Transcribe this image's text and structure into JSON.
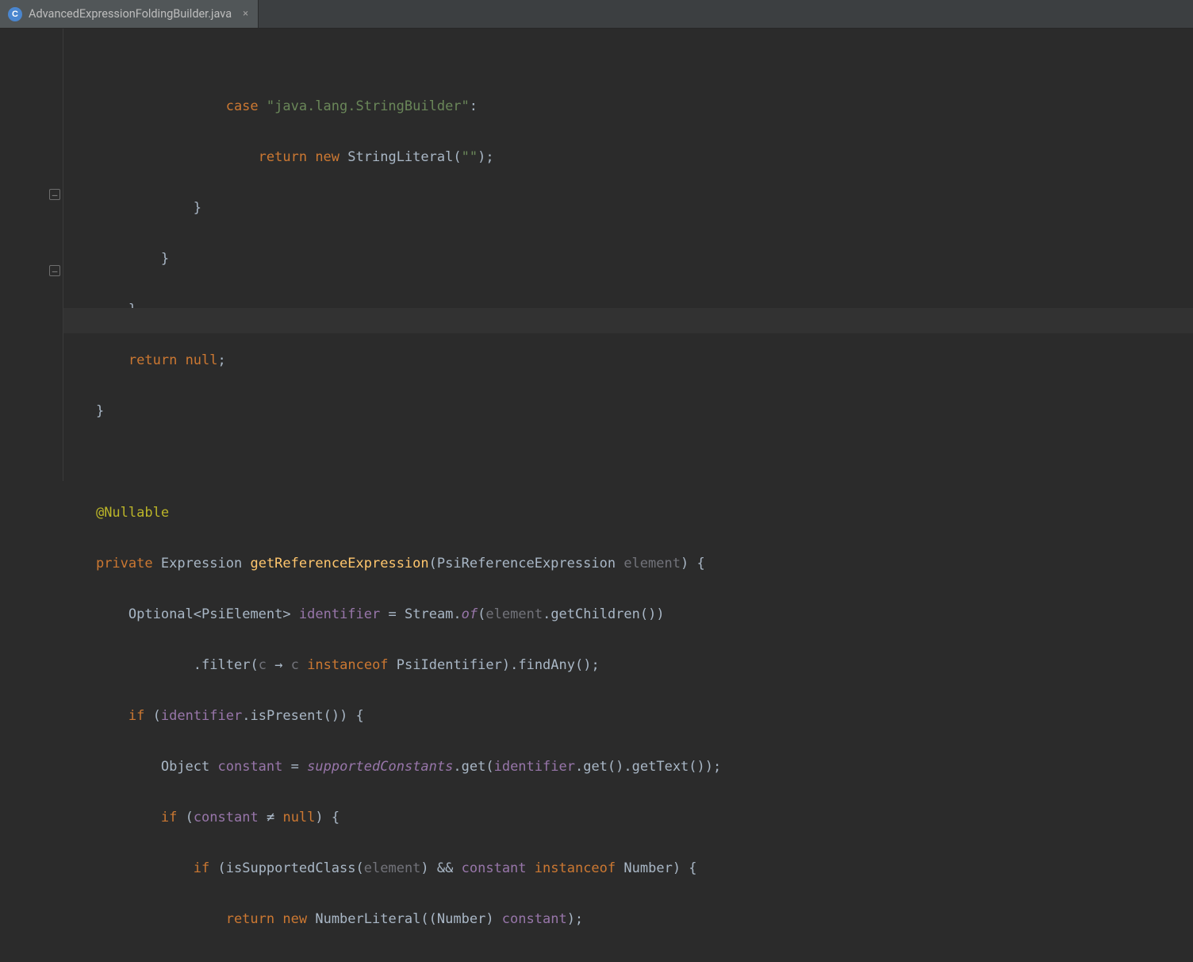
{
  "tab": {
    "filename": "AdvancedExpressionFoldingBuilder.java",
    "file_icon_letter": "C"
  },
  "code": {
    "l1": {
      "kw_case": "case",
      "str": "\"java.lang.StringBuilder\""
    },
    "l2": {
      "kw_return": "return",
      "kw_new": "new",
      "call": "StringLiteral",
      "str": "\"\""
    },
    "l6": {
      "kw_return": "return",
      "kw_null": "null"
    },
    "l9": {
      "ann": "@Nullable"
    },
    "l10": {
      "kw_private": "private",
      "type": "Expression",
      "fn": "getReferenceExpression",
      "ptype": "PsiReferenceExpression",
      "pname": "element"
    },
    "l11": {
      "t1": "Optional",
      "t2": "PsiElement",
      "var": "identifier",
      "stream": "Stream",
      "of": "of",
      "el": "element",
      "gc": "getChildren"
    },
    "l12": {
      "filter": "filter",
      "lp": "c",
      "arrow": "→",
      "c2": "c",
      "io": "instanceof",
      "pid": "PsiIdentifier",
      "fa": "findAny"
    },
    "l13": {
      "kw_if": "if",
      "var": "identifier",
      "isp": "isPresent"
    },
    "l14": {
      "obj": "Object",
      "var": "constant",
      "sc": "supportedConstants",
      "get": "get",
      "id": "identifier",
      "g2": "get",
      "gt": "getText"
    },
    "l15": {
      "kw_if": "if",
      "var": "constant",
      "ne": "≠",
      "kw_null": "null"
    },
    "l16": {
      "kw_if": "if",
      "fn": "isSupportedClass",
      "el": "element",
      "amp": "&&",
      "var": "constant",
      "io": "instanceof",
      "num": "Number"
    },
    "l17": {
      "kw_return": "return",
      "kw_new": "new",
      "nl": "NumberLiteral",
      "num": "Number",
      "var": "constant"
    }
  }
}
